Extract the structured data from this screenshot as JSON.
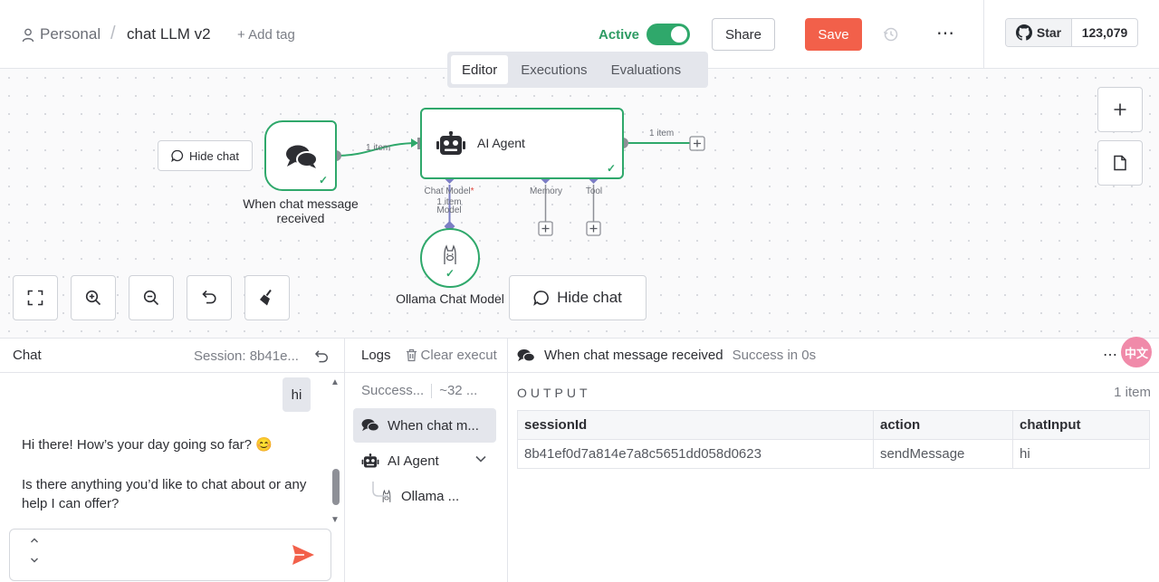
{
  "header": {
    "breadcrumb_project": "Personal",
    "breadcrumb_separator": "/",
    "workflow_name": "chat LLM v2",
    "add_tag": "+ Add tag",
    "active_label": "Active",
    "active": true,
    "share_label": "Share",
    "save_label": "Save",
    "more_label": "⋯",
    "github_star_label": "Star",
    "github_star_count": "123,079"
  },
  "tabs": [
    {
      "label": "Editor",
      "active": true
    },
    {
      "label": "Executions",
      "active": false
    },
    {
      "label": "Evaluations",
      "active": false
    }
  ],
  "canvas": {
    "hide_chat_small": "Hide chat",
    "hide_chat_big": "Hide chat",
    "trigger_label": "When chat message received",
    "agent_label": "AI Agent",
    "ollama_label": "Ollama Chat Model",
    "edge_trigger_agent": "1 item",
    "edge_agent_out": "1 item",
    "port_chat_model": "Chat Model",
    "port_required_marker": "*",
    "port_chat_model_items": "1 item",
    "port_chat_model_sub": "Model",
    "port_memory": "Memory",
    "port_tool": "Tool"
  },
  "chat": {
    "title": "Chat",
    "session": "Session: 8b41e...",
    "messages": [
      {
        "role": "user",
        "text": "hi"
      },
      {
        "role": "bot",
        "text": "Hi there! How’s your day going so far? 😊"
      },
      {
        "role": "bot",
        "text": "Is there anything you’d like to chat about or any help I can offer?"
      }
    ],
    "input_placeholder": ""
  },
  "logs": {
    "title": "Logs",
    "clear_label": "Clear execut",
    "summary_status": "Success...",
    "summary_tokens": "~32 ...",
    "rows": [
      {
        "label": "When chat m..."
      },
      {
        "label": "AI Agent"
      },
      {
        "label": "Ollama ..."
      }
    ]
  },
  "output": {
    "node_name": "When chat message received",
    "status": "Success in 0s",
    "section_label": "OUTPUT",
    "item_count": "1 item",
    "translate_badge": "中文",
    "columns": [
      "sessionId",
      "action",
      "chatInput"
    ],
    "rows": [
      [
        "8b41ef0d7a814e7a8c5651dd058d0623",
        "sendMessage",
        "hi"
      ]
    ]
  },
  "colors": {
    "accent_green": "#2fa86b",
    "save_red": "#f2604a",
    "port_purple": "#7b7ec4"
  }
}
